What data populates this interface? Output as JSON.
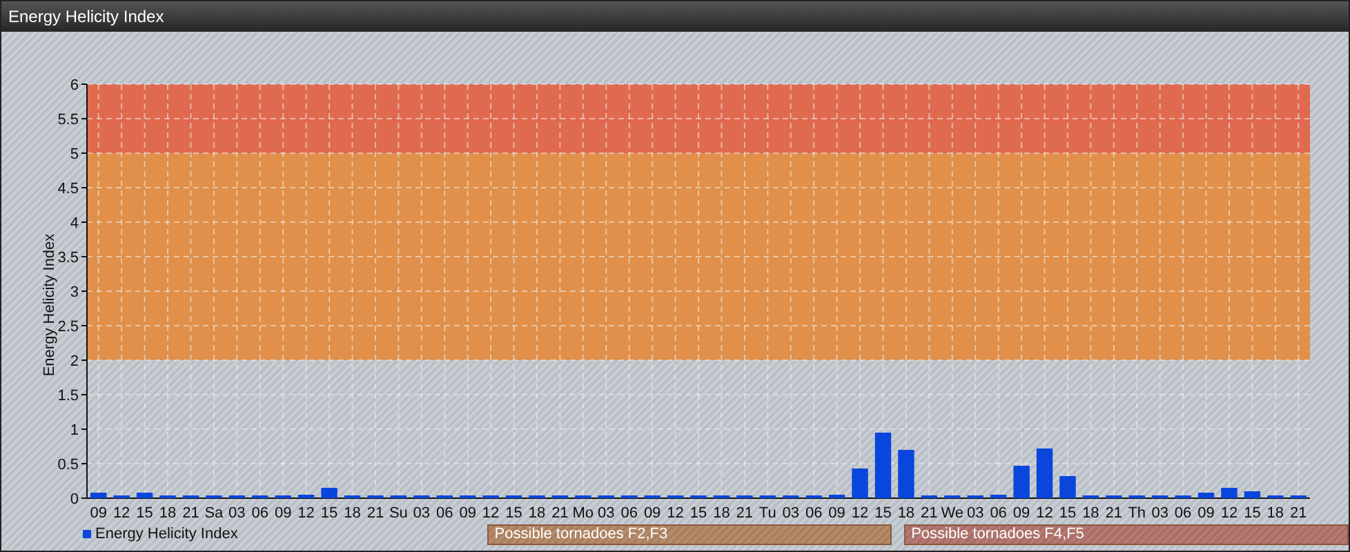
{
  "window": {
    "title": "Energy Helicity Index"
  },
  "chart": {
    "chart_data": {
      "type": "bar",
      "ylabel": "Energy Helicity Index",
      "categories": [
        "09",
        "12",
        "15",
        "18",
        "21",
        "Sa",
        "03",
        "06",
        "09",
        "12",
        "15",
        "18",
        "21",
        "Su",
        "03",
        "06",
        "09",
        "12",
        "15",
        "18",
        "21",
        "Mo",
        "03",
        "06",
        "09",
        "12",
        "15",
        "18",
        "21",
        "Tu",
        "03",
        "06",
        "09",
        "12",
        "15",
        "18",
        "21",
        "We",
        "03",
        "06",
        "09",
        "12",
        "15",
        "18",
        "21",
        "Th",
        "03",
        "06",
        "09",
        "12",
        "15",
        "18",
        "21"
      ],
      "series": [
        {
          "name": "Energy Helicity Index",
          "color": "#0a46dc",
          "values": [
            0.08,
            0.04,
            0.08,
            0.04,
            0.04,
            0.04,
            0.04,
            0.04,
            0.04,
            0.05,
            0.15,
            0.04,
            0.04,
            0.04,
            0.04,
            0.04,
            0.04,
            0.04,
            0.04,
            0.04,
            0.04,
            0.04,
            0.04,
            0.04,
            0.04,
            0.04,
            0.04,
            0.04,
            0.04,
            0.04,
            0.04,
            0.04,
            0.05,
            0.43,
            0.95,
            0.7,
            0.04,
            0.04,
            0.04,
            0.05,
            0.47,
            0.72,
            0.32,
            0.04,
            0.04,
            0.04,
            0.04,
            0.04,
            0.08,
            0.15,
            0.1,
            0.04,
            0.04
          ]
        }
      ],
      "ylim": [
        0,
        6
      ],
      "yticks": [
        0,
        {
          "value": 0.5,
          "label": "0.5"
        },
        1,
        {
          "value": 1.5,
          "label": "1.5"
        },
        2,
        {
          "value": 2.5,
          "label": "2.5"
        },
        3,
        {
          "value": 3.5,
          "label": "3.5"
        },
        4,
        {
          "value": 4.5,
          "label": "4.5"
        },
        5,
        {
          "value": 5.5,
          "label": "5.5"
        },
        6
      ],
      "grid": true,
      "bands": [
        {
          "axis": "y",
          "from": 2,
          "to": 5,
          "color": "#e0904a"
        },
        {
          "axis": "y",
          "from": 5,
          "to": 6,
          "color": "#e06a50"
        }
      ]
    },
    "zones": [
      {
        "label": "Possible tornadoes F2,F3",
        "color": "#b08462"
      },
      {
        "label": "Possible tornadoes F4,F5",
        "color": "#b0726a"
      }
    ]
  }
}
